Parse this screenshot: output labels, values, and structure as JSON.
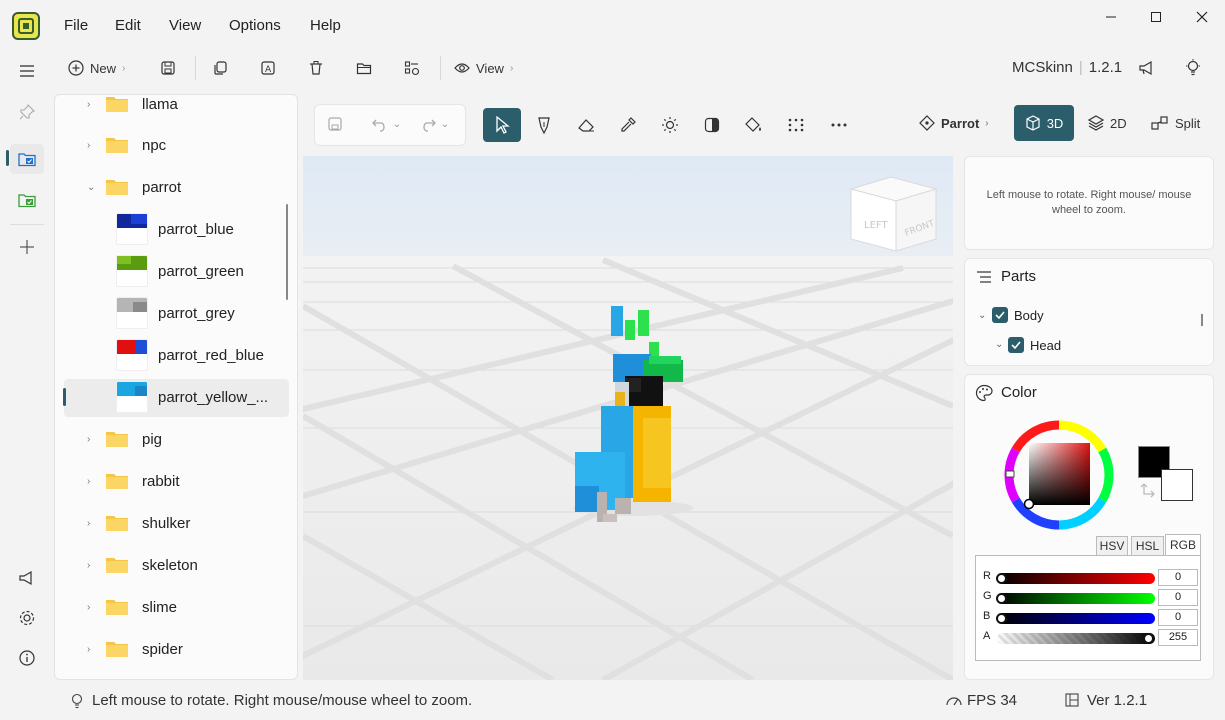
{
  "menu": {
    "file": "File",
    "edit": "Edit",
    "view": "View",
    "options": "Options",
    "help": "Help"
  },
  "toolbar": {
    "new_label": "New",
    "view_label": "View",
    "app_name": "MCSkinn",
    "app_version": "1.2.1"
  },
  "tree": {
    "folders_top": [
      {
        "name": "llama"
      },
      {
        "name": "npc"
      },
      {
        "name": "parrot"
      }
    ],
    "textures": [
      {
        "name": "parrot_blue",
        "color1": "#10289c",
        "color2": "#1d3fd6"
      },
      {
        "name": "parrot_green",
        "color1": "#5a9c10",
        "color2": "#7fbf1f"
      },
      {
        "name": "parrot_grey",
        "color1": "#9a9a9a",
        "color2": "#b5b5b5"
      },
      {
        "name": "parrot_red_blue",
        "color1": "#e01010",
        "color2": "#1d4fd6"
      },
      {
        "name": "parrot_yellow_...",
        "color1": "#1aa6e0",
        "color2": "#33b8ec"
      }
    ],
    "folders_bottom": [
      {
        "name": "pig"
      },
      {
        "name": "rabbit"
      },
      {
        "name": "shulker"
      },
      {
        "name": "skeleton"
      },
      {
        "name": "slime"
      },
      {
        "name": "spider"
      }
    ]
  },
  "editor": {
    "model_name": "Parrot",
    "mode_3d": "3D",
    "mode_2d": "2D",
    "mode_split": "Split",
    "cube_left": "LEFT",
    "cube_front": "FRONT"
  },
  "hint": {
    "text": "Left mouse to rotate. Right mouse/ mouse wheel to zoom."
  },
  "parts": {
    "title": "Parts",
    "body": "Body",
    "head": "Head"
  },
  "color": {
    "title": "Color",
    "tabs": {
      "hsv": "HSV",
      "hsl": "HSL",
      "rgb": "RGB"
    },
    "r_label": "R",
    "g_label": "G",
    "b_label": "B",
    "a_label": "A",
    "r": "0",
    "g": "0",
    "b": "0",
    "a": "255",
    "primary": "#000000",
    "secondary": "#ffffff"
  },
  "status": {
    "message": "Left mouse to rotate. Right mouse/mouse wheel to zoom.",
    "fps": "FPS 34",
    "version": "Ver 1.2.1"
  },
  "accent": "#2c5d6b"
}
